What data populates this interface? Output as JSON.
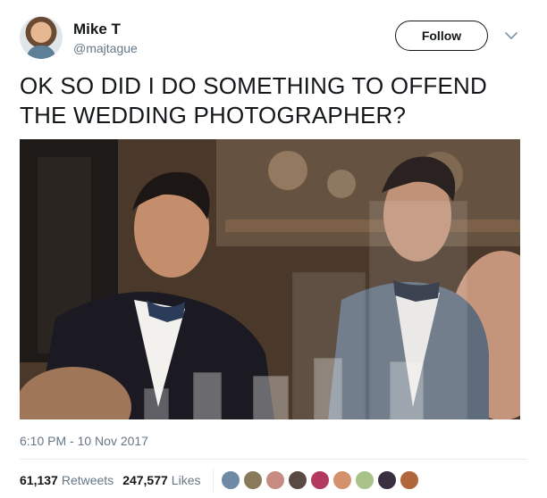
{
  "user": {
    "name": "Mike T",
    "handle": "@majtague"
  },
  "follow_button": {
    "label": "Follow"
  },
  "tweet": {
    "text": "OK SO DID I DO SOMETHING TO OFFEND THE WEDDING PHOTOGRAPHER?",
    "timestamp": "6:10 PM - 10 Nov 2017"
  },
  "stats": {
    "retweets_count": "61,137",
    "retweets_label": "Retweets",
    "likes_count": "247,577",
    "likes_label": "Likes"
  },
  "liker_avatar_colors": [
    "#6f8aa4",
    "#8a7a5c",
    "#c68c84",
    "#5a4a44",
    "#b23a5e",
    "#d4926c",
    "#a8c28a",
    "#3a2f3f",
    "#b0653a"
  ],
  "icons": {
    "more": "chevron-down-icon"
  }
}
